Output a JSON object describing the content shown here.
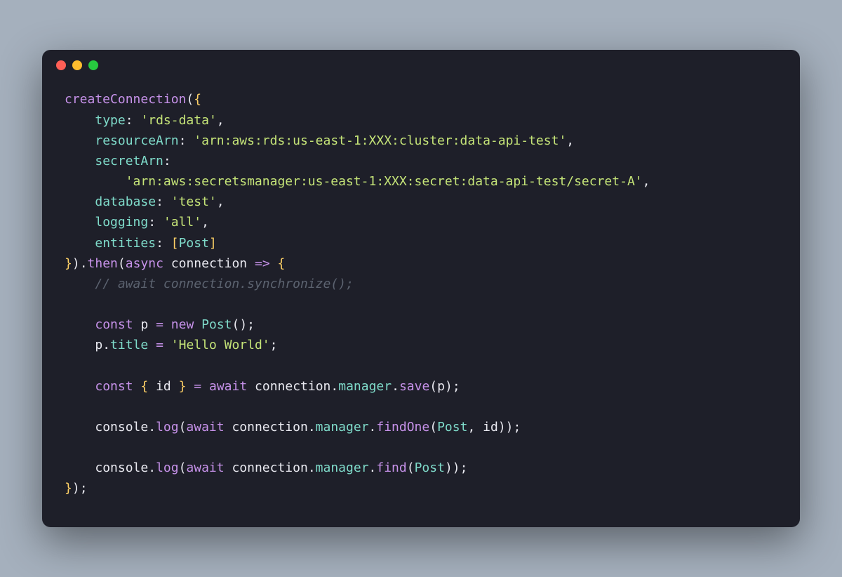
{
  "window": {
    "dots": [
      "red",
      "yellow",
      "green"
    ]
  },
  "code": {
    "fn_createConnection": "createConnection",
    "paren_open": "(",
    "brace_open": "{",
    "prop_type": "type",
    "colon": ":",
    "val_type": "'rds-data'",
    "comma": ",",
    "prop_resourceArn": "resourceArn",
    "val_resourceArn": "'arn:aws:rds:us-east-1:XXX:cluster:data-api-test'",
    "prop_secretArn": "secretArn",
    "val_secretArn": "'arn:aws:secretsmanager:us-east-1:XXX:secret:data-api-test/secret-A'",
    "prop_database": "database",
    "val_database": "'test'",
    "prop_logging": "logging",
    "val_logging": "'all'",
    "prop_entities": "entities",
    "sq_open": "[",
    "id_Post": "Post",
    "sq_close": "]",
    "brace_close": "}",
    "paren_close": ")",
    "dot": ".",
    "fn_then": "then",
    "kw_async": "async",
    "id_connection": "connection",
    "arrow": "=>",
    "comment_sync": "// await connection.synchronize();",
    "kw_const": "const",
    "id_p": "p",
    "eq": "=",
    "kw_new": "new",
    "class_Post": "Post",
    "empty_parens": "()",
    "semi": ";",
    "id_title": "title",
    "val_hello": "'Hello World'",
    "id_id": "id",
    "kw_await": "await",
    "id_manager": "manager",
    "fn_save": "save",
    "id_console": "console",
    "fn_log": "log",
    "fn_findOne": "findOne",
    "fn_find": "find"
  }
}
